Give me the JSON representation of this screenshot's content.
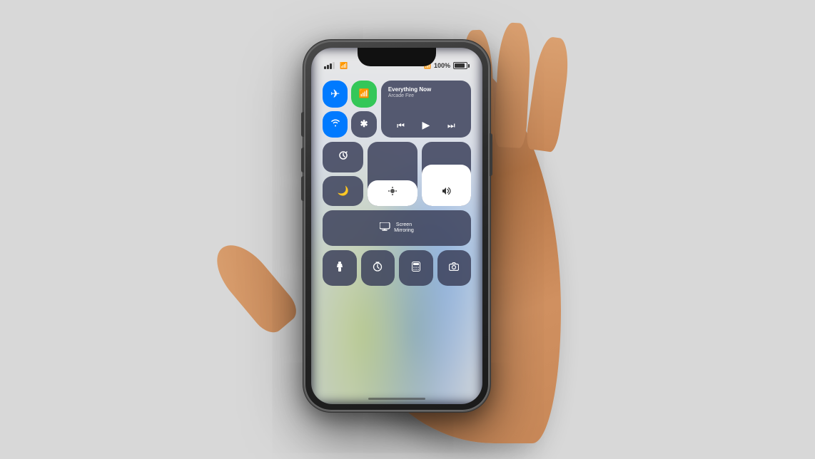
{
  "background": "#d8d8d8",
  "phone": {
    "status_bar": {
      "signal_bars": [
        3,
        4,
        5
      ],
      "wifi": "wifi",
      "bluetooth": "B",
      "battery_percent": "100%",
      "battery_label": "100%"
    },
    "control_center": {
      "connectivity": {
        "airplane_mode": "✈",
        "cellular": "📶",
        "wifi": "wifi",
        "bluetooth": "bluetooth"
      },
      "now_playing": {
        "title": "Everything Now",
        "artist": "Arcade Fire",
        "controls": {
          "prev": "⏮",
          "play": "▶",
          "next": "⏭"
        }
      },
      "orientation_lock": "🔒",
      "do_not_disturb": "🌙",
      "screen_mirroring": {
        "icon": "📺",
        "label": "Screen\nMirroring"
      },
      "brightness_level": 40,
      "volume_level": 65,
      "flashlight": "🔦",
      "timer": "⏱",
      "calculator": "🔢",
      "camera": "📷"
    }
  }
}
